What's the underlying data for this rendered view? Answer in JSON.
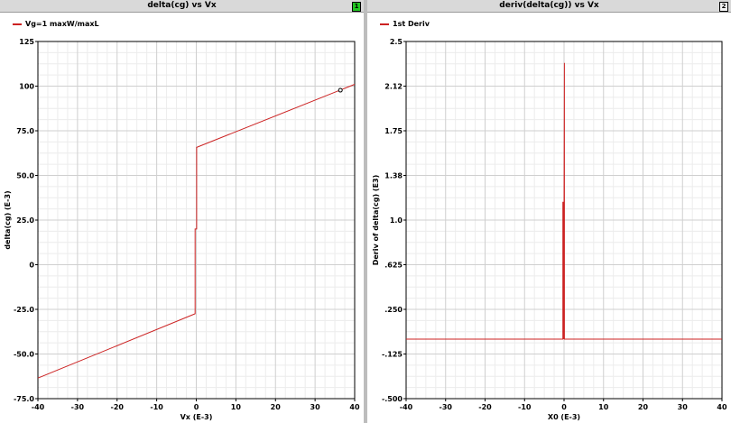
{
  "panels": [
    {
      "title": "delta(cg) vs Vx",
      "number": "1",
      "legend": "Vg=1 maxW/maxL"
    },
    {
      "title": "deriv(delta(cg)) vs Vx",
      "number": "2",
      "legend": "1st Deriv"
    }
  ],
  "chart_data": [
    {
      "type": "line",
      "title": "delta(cg) vs Vx",
      "xlabel": "Vx (E-3)",
      "ylabel": "delta(cg) (E-3)",
      "xlim": [
        -40,
        40
      ],
      "ylim": [
        -75,
        125
      ],
      "xticks": [
        -40,
        -30,
        -20,
        -10,
        0,
        10,
        20,
        30,
        40
      ],
      "xtick_labels": [
        "-40",
        "-30",
        "-20",
        "-10",
        "0",
        "10",
        "20",
        "30",
        "40"
      ],
      "yticks": [
        -75,
        -50,
        -25,
        0,
        25,
        50,
        75,
        100,
        125
      ],
      "ytick_labels": [
        "-75.0",
        "-50.0",
        "-25.0",
        "0",
        "25.0",
        "50.0",
        "75.0",
        "100",
        "125"
      ],
      "grid": true,
      "legend_position": "top-left",
      "series": [
        {
          "name": "Vg=1 maxW/maxL",
          "color": "#cc2222",
          "x": [
            -40,
            -0.3,
            -0.3,
            0.1,
            0.1,
            40
          ],
          "y": [
            -63.5,
            -27.5,
            20,
            20,
            65.7,
            101
          ]
        }
      ],
      "marker": {
        "x": 36.4,
        "y": 97.7
      }
    },
    {
      "type": "line",
      "title": "deriv(delta(cg)) vs Vx",
      "xlabel": "X0 (E-3)",
      "ylabel": "Deriv of delta(cg) (E3)",
      "xlim": [
        -40,
        40
      ],
      "ylim": [
        -0.5,
        2.5
      ],
      "xticks": [
        -40,
        -30,
        -20,
        -10,
        0,
        10,
        20,
        30,
        40
      ],
      "xtick_labels": [
        "-40",
        "-30",
        "-20",
        "-10",
        "0",
        "10",
        "20",
        "30",
        "40"
      ],
      "yticks": [
        -0.5,
        -0.125,
        0.25,
        0.625,
        1.0,
        1.375,
        1.75,
        2.125,
        2.5
      ],
      "ytick_labels": [
        "-.500",
        "-.125",
        ".250",
        ".625",
        "1.0",
        "1.38",
        "1.75",
        "2.12",
        "2.5"
      ],
      "grid": true,
      "legend_position": "top-left",
      "series": [
        {
          "name": "1st Deriv",
          "color": "#cc2222",
          "x": [
            -40,
            -0.3,
            -0.3,
            -0.1,
            -0.1,
            0.1,
            0.1,
            40
          ],
          "y": [
            0.0,
            0.0,
            1.15,
            1.15,
            0.0,
            2.32,
            0.0,
            0.0
          ]
        }
      ]
    }
  ]
}
